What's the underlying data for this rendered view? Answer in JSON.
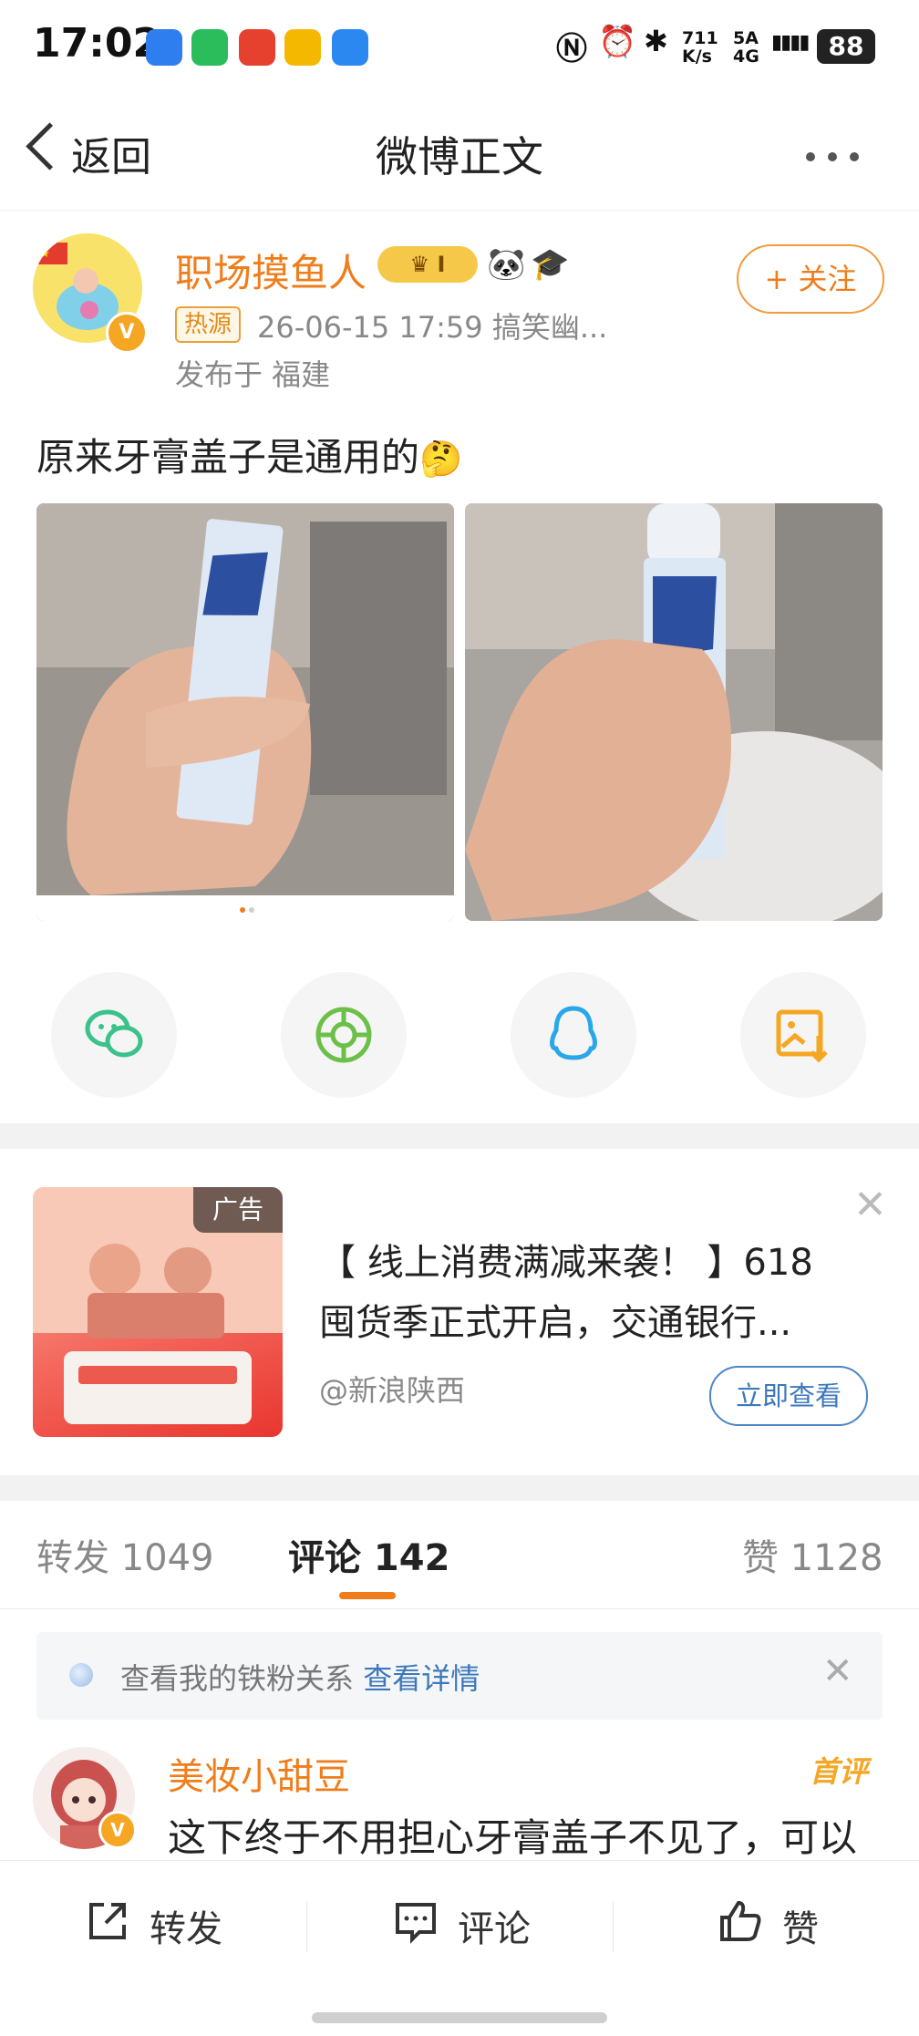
{
  "status_bar": {
    "time": "17:02",
    "net_speed": "711\nK/s",
    "signal": "5A 4G",
    "battery": "88"
  },
  "nav": {
    "back_label": "返回",
    "title": "微博正文"
  },
  "author": {
    "name": "职场摸鱼人",
    "crown_badge": "I",
    "hot_tag": "热源",
    "meta": "26-06-15 17:59  搞笑幽...",
    "location": "发布于 福建",
    "follow_label": "+ 关注"
  },
  "post": {
    "text": "原来牙膏盖子是通用的"
  },
  "ad": {
    "tag": "广告",
    "title": "【 线上消费满减来袭！ 】618囤货季正式开启，交通银行...",
    "source": "@新浪陕西",
    "button": "立即查看"
  },
  "tabs": {
    "repost": "转发 1049",
    "comment": "评论 142",
    "like": "赞 1128"
  },
  "fans_bar": {
    "text": "查看我的铁粉关系",
    "link": "查看详情"
  },
  "comment": {
    "name": "美妆小甜豆",
    "first_tag": "首评",
    "text": "这下终于不用担心牙膏盖子不见了，可以"
  },
  "bottom_bar": {
    "repost": "转发",
    "comment": "评论",
    "like": "赞"
  },
  "colors": {
    "accent_orange": "#f07d1b",
    "link_blue": "#3d78bb"
  }
}
